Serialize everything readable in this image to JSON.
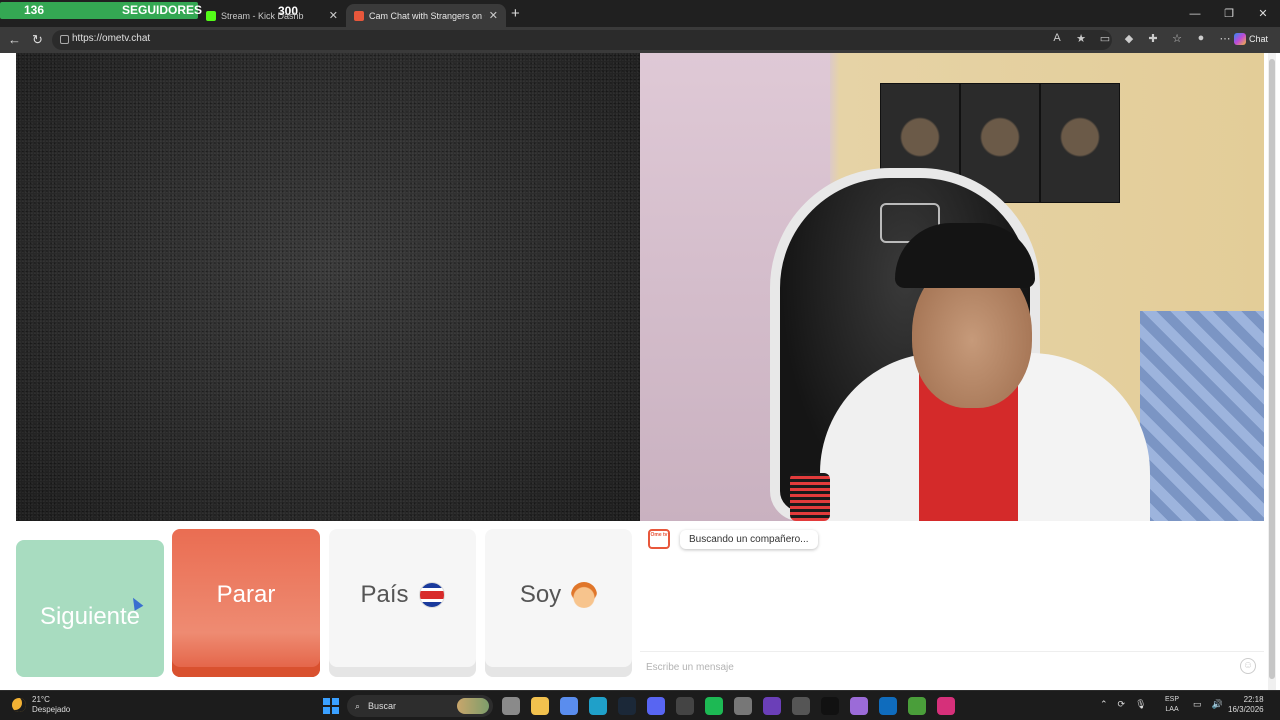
{
  "browser": {
    "follower_widget": {
      "count": "136",
      "label": "SEGUIDORES",
      "goal": "300",
      "progress_fraction": 0.45
    },
    "tabs": [
      {
        "title": "Stream - Kick Dashb",
        "active": false,
        "favicon_color": "#53fc18"
      },
      {
        "title": "Cam Chat with Strangers on O",
        "active": true,
        "favicon_color": "#e8573b"
      }
    ],
    "new_tab_label": "+",
    "url": "https://ometv.chat",
    "copilot_label": "Chat"
  },
  "app": {
    "buttons": {
      "next": "Siguiente",
      "stop": "Parar",
      "country": "País",
      "gender": "Soy"
    },
    "chat": {
      "logo_text": "Ome tv",
      "status": "Buscando un compañero...",
      "placeholder": "Escribe un mensaje"
    },
    "colors": {
      "next": "#a8dcc0",
      "stop": "#ea6d52",
      "neutral": "#f6f6f6"
    }
  },
  "taskbar": {
    "weather_temp": "21°C",
    "weather_desc": "Despejado",
    "search_label": "Buscar",
    "lang_line1": "ESP",
    "lang_line2": "LAA",
    "time": "22:18",
    "date": "16/3/2026",
    "apps": [
      {
        "name": "task-view-icon",
        "color": "#8a8a8a"
      },
      {
        "name": "file-explorer-icon",
        "color": "#f2c14e"
      },
      {
        "name": "store-icon",
        "color": "#5a8dee"
      },
      {
        "name": "edge-icon",
        "color": "#1fa0c9"
      },
      {
        "name": "steam-icon",
        "color": "#1b2838"
      },
      {
        "name": "discord-icon",
        "color": "#5865f2"
      },
      {
        "name": "github-icon",
        "color": "#444"
      },
      {
        "name": "spotify-icon",
        "color": "#1db954"
      },
      {
        "name": "settings-icon",
        "color": "#777"
      },
      {
        "name": "obs-icon",
        "color": "#6b3fb8"
      },
      {
        "name": "keyboard-icon",
        "color": "#555"
      },
      {
        "name": "tiktok-icon",
        "color": "#111"
      },
      {
        "name": "copilot-icon",
        "color": "#9b6bd8"
      },
      {
        "name": "outlook-icon",
        "color": "#0f6cbd"
      },
      {
        "name": "minecraft-icon",
        "color": "#4a9e3a"
      },
      {
        "name": "instagram-icon",
        "color": "#d6307a"
      }
    ]
  }
}
